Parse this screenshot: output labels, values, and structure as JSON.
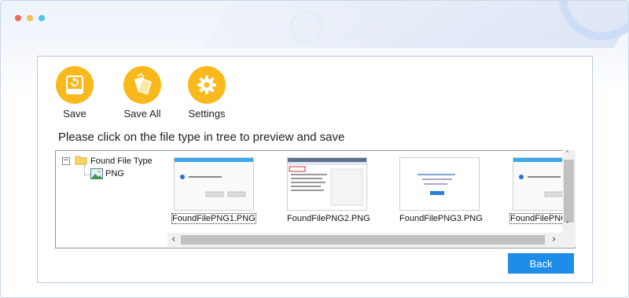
{
  "window": {
    "dots": [
      {
        "name": "close-dot",
        "color": "#f26b63"
      },
      {
        "name": "minimize-dot",
        "color": "#f6bf4f"
      },
      {
        "name": "maximize-dot",
        "color": "#4ac6e6"
      }
    ]
  },
  "toolbar": {
    "save_label": "Save",
    "save_all_label": "Save All",
    "settings_label": "Settings",
    "accent_color": "#f9b91c"
  },
  "instruction": "Please click on the file type in tree to preview and save",
  "tree": {
    "root_label": "Found File Type",
    "expander": "−",
    "child_label": "PNG"
  },
  "files": [
    {
      "name": "FoundFilePNG1.PNG",
      "selected": true
    },
    {
      "name": "FoundFilePNG2.PNG",
      "selected": false
    },
    {
      "name": "FoundFilePNG3.PNG",
      "selected": false
    },
    {
      "name": "FoundFilePNG",
      "selected": false
    }
  ],
  "scroll": {
    "up": "˄",
    "down": "˅",
    "left": "‹",
    "right": "›"
  },
  "back_label": "Back",
  "back_color": "#1e8de9"
}
